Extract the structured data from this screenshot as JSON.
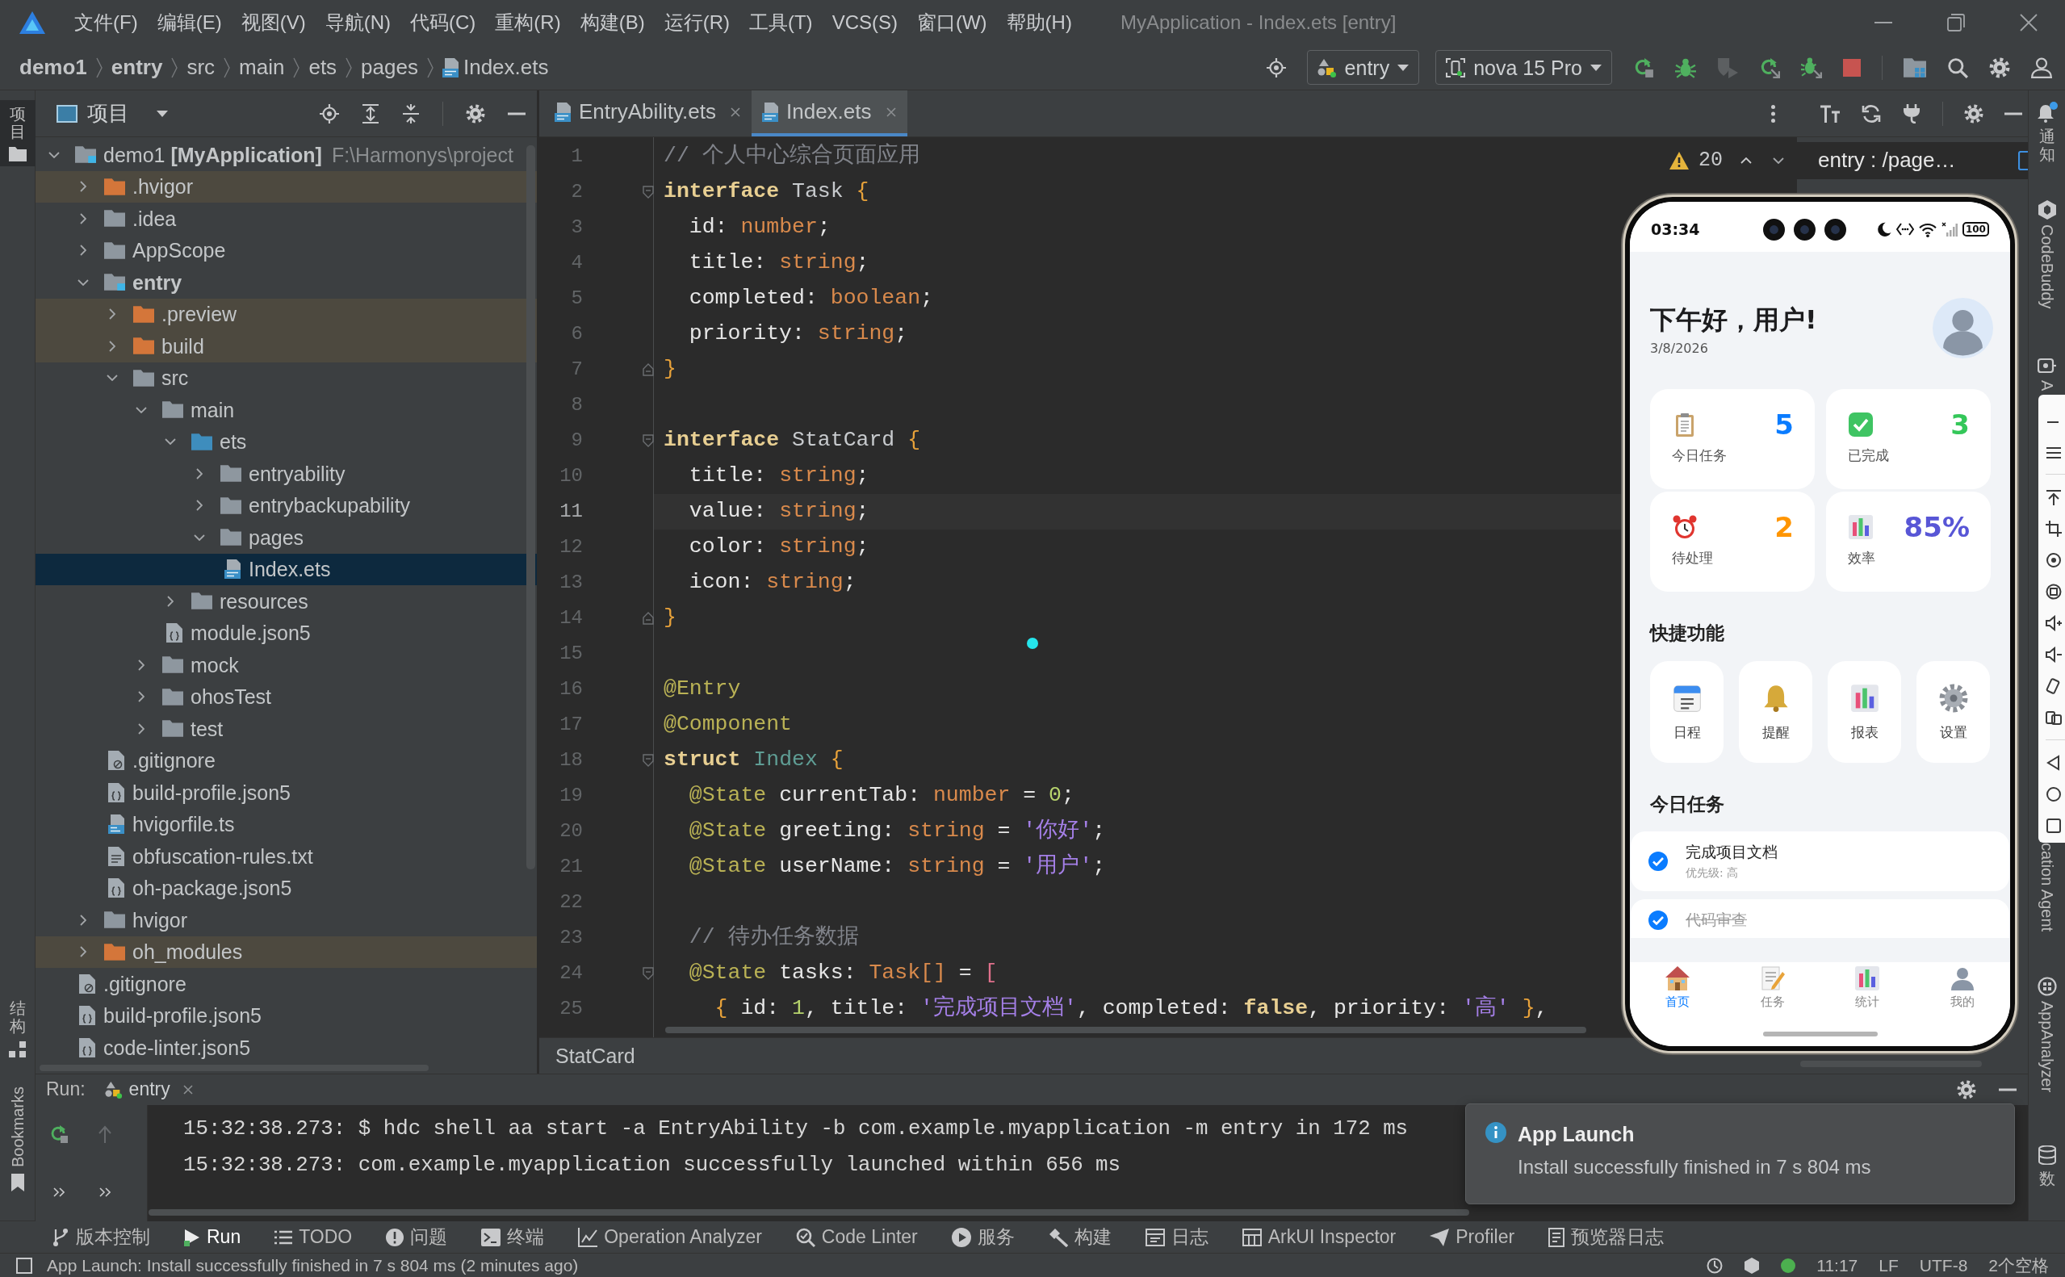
{
  "title_bar": {
    "menus": [
      "文件(F)",
      "编辑(E)",
      "视图(V)",
      "导航(N)",
      "代码(C)",
      "重构(R)",
      "构建(B)",
      "运行(R)",
      "工具(T)",
      "VCS(S)",
      "窗口(W)",
      "帮助(H)"
    ],
    "title": "MyApplication - Index.ets [entry]"
  },
  "nav_bar": {
    "breadcrumbs": [
      {
        "label": "demo1",
        "kind": "module"
      },
      {
        "label": "entry",
        "kind": "module"
      },
      {
        "label": "src",
        "kind": "folder"
      },
      {
        "label": "main",
        "kind": "folder"
      },
      {
        "label": "ets",
        "kind": "folder"
      },
      {
        "label": "pages",
        "kind": "folder"
      },
      {
        "label": "Index.ets",
        "kind": "file"
      }
    ],
    "run_config": "entry",
    "device": "nova 15 Pro"
  },
  "left_stripe": [
    {
      "label": "项目",
      "kind": "stacked",
      "selected": true
    },
    {
      "label": "结构",
      "kind": "stacked",
      "selected": false
    },
    {
      "label": "Bookmarks",
      "kind": "rotated",
      "selected": false
    }
  ],
  "project_panel": {
    "title": "项目",
    "root": {
      "label": "demo1 **[MyApplication]**",
      "path": "F:\\Harmonys\\project",
      "kind": "project",
      "expanded": true,
      "selected": false,
      "children": [
        {
          "label": ".hvigor",
          "kind": "excluded",
          "expanded": false,
          "selected": false
        },
        {
          "label": ".idea",
          "kind": "folder",
          "expanded": false,
          "selected": false
        },
        {
          "label": "AppScope",
          "kind": "folder",
          "expanded": false,
          "selected": false
        },
        {
          "label": "entry",
          "kind": "module",
          "expanded": true,
          "selected": false,
          "children": [
            {
              "label": ".preview",
              "kind": "excluded",
              "expanded": false,
              "selected": false
            },
            {
              "label": "build",
              "kind": "excluded",
              "expanded": false,
              "selected": false
            },
            {
              "label": "src",
              "kind": "folder",
              "expanded": true,
              "selected": false,
              "children": [
                {
                  "label": "main",
                  "kind": "folder",
                  "expanded": true,
                  "selected": false,
                  "children": [
                    {
                      "label": "ets",
                      "kind": "source",
                      "expanded": true,
                      "selected": false,
                      "children": [
                        {
                          "label": "entryability",
                          "kind": "folder",
                          "expanded": false,
                          "selected": false
                        },
                        {
                          "label": "entrybackupability",
                          "kind": "folder",
                          "expanded": false,
                          "selected": false
                        },
                        {
                          "label": "pages",
                          "kind": "folder",
                          "expanded": true,
                          "selected": false,
                          "children": [
                            {
                              "label": "Index.ets",
                              "kind": "ets",
                              "selected": true
                            }
                          ]
                        }
                      ]
                    },
                    {
                      "label": "resources",
                      "kind": "folder",
                      "expanded": false,
                      "selected": false
                    },
                    {
                      "label": "module.json5",
                      "kind": "json",
                      "selected": false
                    }
                  ]
                },
                {
                  "label": "mock",
                  "kind": "folder",
                  "expanded": false,
                  "selected": false
                },
                {
                  "label": "ohosTest",
                  "kind": "folder",
                  "expanded": false,
                  "selected": false
                },
                {
                  "label": "test",
                  "kind": "folder",
                  "expanded": false,
                  "selected": false
                }
              ]
            },
            {
              "label": ".gitignore",
              "kind": "ignore",
              "selected": false
            },
            {
              "label": "build-profile.json5",
              "kind": "json",
              "selected": false
            },
            {
              "label": "hvigorfile.ts",
              "kind": "ts",
              "selected": false
            },
            {
              "label": "obfuscation-rules.txt",
              "kind": "text",
              "selected": false
            },
            {
              "label": "oh-package.json5",
              "kind": "json",
              "selected": false
            }
          ]
        },
        {
          "label": "hvigor",
          "kind": "folder",
          "expanded": false,
          "selected": false
        },
        {
          "label": "oh_modules",
          "kind": "excluded",
          "expanded": false,
          "selected": false
        },
        {
          "label": ".gitignore",
          "kind": "ignore",
          "selected": false
        },
        {
          "label": "build-profile.json5",
          "kind": "json",
          "selected": false
        },
        {
          "label": "code-linter.json5",
          "kind": "json",
          "selected": false
        }
      ]
    }
  },
  "editor": {
    "tabs": [
      {
        "label": "EntryAbility.ets",
        "selected": false
      },
      {
        "label": "Index.ets",
        "selected": true
      }
    ],
    "warnings": "20",
    "lines": [
      {
        "number": "1",
        "kind": "plain",
        "current": false,
        "tokens": [
          {
            "kind": "comment",
            "text": "// 个人中心综合页面应用"
          }
        ]
      },
      {
        "number": "2",
        "kind": "open",
        "current": false,
        "tokens": [
          {
            "kind": "keyword",
            "text": "interface"
          },
          {
            "kind": "name",
            "text": " Task "
          },
          {
            "kind": "brace",
            "text": "{"
          }
        ]
      },
      {
        "number": "3",
        "kind": "plain",
        "current": false,
        "tokens": [
          {
            "kind": "plain",
            "text": "  id: "
          },
          {
            "kind": "builtin",
            "text": "number"
          },
          {
            "kind": "plain",
            "text": ";"
          }
        ]
      },
      {
        "number": "4",
        "kind": "plain",
        "current": false,
        "tokens": [
          {
            "kind": "plain",
            "text": "  title: "
          },
          {
            "kind": "builtin",
            "text": "string"
          },
          {
            "kind": "plain",
            "text": ";"
          }
        ]
      },
      {
        "number": "5",
        "kind": "plain",
        "current": false,
        "tokens": [
          {
            "kind": "plain",
            "text": "  completed: "
          },
          {
            "kind": "builtin",
            "text": "boolean"
          },
          {
            "kind": "plain",
            "text": ";"
          }
        ]
      },
      {
        "number": "6",
        "kind": "plain",
        "current": false,
        "tokens": [
          {
            "kind": "plain",
            "text": "  priority: "
          },
          {
            "kind": "builtin",
            "text": "string"
          },
          {
            "kind": "plain",
            "text": ";"
          }
        ]
      },
      {
        "number": "7",
        "kind": "close",
        "current": false,
        "tokens": [
          {
            "kind": "brace",
            "text": "}"
          }
        ]
      },
      {
        "number": "8",
        "kind": "plain",
        "current": false
      },
      {
        "number": "9",
        "kind": "open",
        "current": false,
        "tokens": [
          {
            "kind": "keyword",
            "text": "interface"
          },
          {
            "kind": "name",
            "text": " StatCard "
          },
          {
            "kind": "brace",
            "text": "{"
          }
        ]
      },
      {
        "number": "10",
        "kind": "plain",
        "current": false,
        "tokens": [
          {
            "kind": "plain",
            "text": "  title: "
          },
          {
            "kind": "builtin",
            "text": "string"
          },
          {
            "kind": "plain",
            "text": ";"
          }
        ]
      },
      {
        "number": "11",
        "kind": "plain",
        "current": true,
        "tokens": [
          {
            "kind": "plain",
            "text": "  value: "
          },
          {
            "kind": "builtin",
            "text": "string"
          },
          {
            "kind": "plain",
            "text": ";"
          }
        ]
      },
      {
        "number": "12",
        "kind": "plain",
        "current": false,
        "tokens": [
          {
            "kind": "plain",
            "text": "  color: "
          },
          {
            "kind": "builtin",
            "text": "string"
          },
          {
            "kind": "plain",
            "text": ";"
          }
        ]
      },
      {
        "number": "13",
        "kind": "plain",
        "current": false,
        "tokens": [
          {
            "kind": "plain",
            "text": "  icon: "
          },
          {
            "kind": "builtin",
            "text": "string"
          },
          {
            "kind": "plain",
            "text": ";"
          }
        ]
      },
      {
        "number": "14",
        "kind": "close",
        "current": false,
        "tokens": [
          {
            "kind": "brace",
            "text": "}"
          }
        ]
      },
      {
        "number": "15",
        "kind": "plain",
        "current": false
      },
      {
        "number": "16",
        "kind": "plain",
        "current": false,
        "tokens": [
          {
            "kind": "decorator",
            "text": "@Entry"
          }
        ]
      },
      {
        "number": "17",
        "kind": "plain",
        "current": false,
        "tokens": [
          {
            "kind": "decorator",
            "text": "@Component"
          }
        ]
      },
      {
        "number": "18",
        "kind": "open",
        "current": false,
        "tokens": [
          {
            "kind": "keyword",
            "text": "struct"
          },
          {
            "kind": "struct",
            "text": " Index "
          },
          {
            "kind": "brace",
            "text": "{"
          }
        ]
      },
      {
        "number": "19",
        "kind": "plain",
        "current": false,
        "tokens": [
          {
            "kind": "decorator",
            "text": "  @State"
          },
          {
            "kind": "plain",
            "text": " currentTab: "
          },
          {
            "kind": "builtin",
            "text": "number"
          },
          {
            "kind": "plain",
            "text": " = "
          },
          {
            "kind": "number",
            "text": "0"
          },
          {
            "kind": "plain",
            "text": ";"
          }
        ]
      },
      {
        "number": "20",
        "kind": "plain",
        "current": false,
        "tokens": [
          {
            "kind": "decorator",
            "text": "  @State"
          },
          {
            "kind": "plain",
            "text": " greeting: "
          },
          {
            "kind": "builtin",
            "text": "string"
          },
          {
            "kind": "plain",
            "text": " = "
          },
          {
            "kind": "string",
            "text": "'你好'"
          },
          {
            "kind": "plain",
            "text": ";"
          }
        ]
      },
      {
        "number": "21",
        "kind": "plain",
        "current": false,
        "tokens": [
          {
            "kind": "decorator",
            "text": "  @State"
          },
          {
            "kind": "plain",
            "text": " userName: "
          },
          {
            "kind": "builtin",
            "text": "string"
          },
          {
            "kind": "plain",
            "text": " = "
          },
          {
            "kind": "string",
            "text": "'用户'"
          },
          {
            "kind": "plain",
            "text": ";"
          }
        ]
      },
      {
        "number": "22",
        "kind": "plain",
        "current": false
      },
      {
        "number": "23",
        "kind": "plain",
        "current": false,
        "tokens": [
          {
            "kind": "comment",
            "text": "  // 待办任务数据"
          }
        ]
      },
      {
        "number": "24",
        "kind": "open",
        "current": false,
        "tokens": [
          {
            "kind": "decorator",
            "text": "  @State"
          },
          {
            "kind": "plain",
            "text": " tasks: "
          },
          {
            "kind": "builtin",
            "text": "Task[]"
          },
          {
            "kind": "plain",
            "text": " = "
          },
          {
            "kind": "bracket",
            "text": "["
          }
        ]
      },
      {
        "number": "25",
        "kind": "plain",
        "current": false,
        "tokens": [
          {
            "kind": "brace",
            "text": "    {"
          },
          {
            "kind": "plain",
            "text": " id: "
          },
          {
            "kind": "number",
            "text": "1"
          },
          {
            "kind": "plain",
            "text": ", title: "
          },
          {
            "kind": "string",
            "text": "'完成项目文档'"
          },
          {
            "kind": "plain",
            "text": ", completed: "
          },
          {
            "kind": "bool",
            "text": "false"
          },
          {
            "kind": "plain",
            "text": ", priority: "
          },
          {
            "kind": "string",
            "text": "'高'"
          },
          {
            "kind": "brace",
            "text": " }"
          },
          {
            "kind": "plain",
            "text": ","
          }
        ]
      }
    ],
    "breadcrumb": "StatCard"
  },
  "preview": {
    "tab": "entry : /page…",
    "phone": {
      "time": "03:34",
      "battery": "100",
      "greeting": "下午好，用户!",
      "date": "3/8/2026",
      "stats": [
        {
          "label": "今日任务",
          "value": "5",
          "color": "#0a7cff"
        },
        {
          "label": "已完成",
          "value": "3",
          "color": "#34c759"
        },
        {
          "label": "待处理",
          "value": "2",
          "color": "#ff9500"
        },
        {
          "label": "效率",
          "value": "85%",
          "color": "#5856d6"
        }
      ],
      "quick_title": "快捷功能",
      "quick_actions": [
        "日程",
        "提醒",
        "报表",
        "设置"
      ],
      "tasks_title": "今日任务",
      "tasks": [
        {
          "title": "完成项目文档",
          "priority": "优先级: 高",
          "completed": false
        },
        {
          "title": "代码审查",
          "completed": true
        }
      ],
      "nav": [
        {
          "label": "首页",
          "selected": true
        },
        {
          "label": "任务",
          "selected": false
        },
        {
          "label": "统计",
          "selected": false
        },
        {
          "label": "我的",
          "selected": false
        }
      ]
    }
  },
  "right_stripe": [
    {
      "label": "通知",
      "kind": "stacked"
    },
    {
      "label": "CodeBuddy",
      "kind": "rotated"
    },
    {
      "label": "A",
      "kind": "rotated"
    },
    {
      "label": "cation Agent",
      "kind": "rotated"
    },
    {
      "label": "AppAnalyzer",
      "kind": "rotated"
    },
    {
      "label": "数",
      "kind": "stacked"
    }
  ],
  "run_panel": {
    "title": "Run:",
    "tab": "entry",
    "lines": [
      "15:32:38.273: $ hdc shell aa start -a EntryAbility -b com.example.myapplication -m entry in 172 ms",
      "15:32:38.273: com.example.myapplication successfully launched within 656 ms"
    ]
  },
  "notification": {
    "title": "App Launch",
    "message": "Install successfully finished in 7 s 804 ms"
  },
  "tool_strip": [
    {
      "label": "版本控制",
      "selected": false
    },
    {
      "label": "Run",
      "selected": true
    },
    {
      "label": "TODO",
      "selected": false
    },
    {
      "label": "问题",
      "selected": false
    },
    {
      "label": "终端",
      "selected": false
    },
    {
      "label": "Operation Analyzer",
      "selected": false
    },
    {
      "label": "Code Linter",
      "selected": false
    },
    {
      "label": "服务",
      "selected": false
    },
    {
      "label": "构建",
      "selected": false
    },
    {
      "label": "日志",
      "selected": false
    },
    {
      "label": "ArkUI Inspector",
      "selected": false
    },
    {
      "label": "Profiler",
      "selected": false
    },
    {
      "label": "预览器日志",
      "selected": false
    }
  ],
  "status_bar": {
    "message": "App Launch: Install successfully finished in 7 s 804 ms (2 minutes ago)",
    "items": [
      "11:17",
      "LF",
      "UTF-8",
      "2个空格"
    ]
  }
}
